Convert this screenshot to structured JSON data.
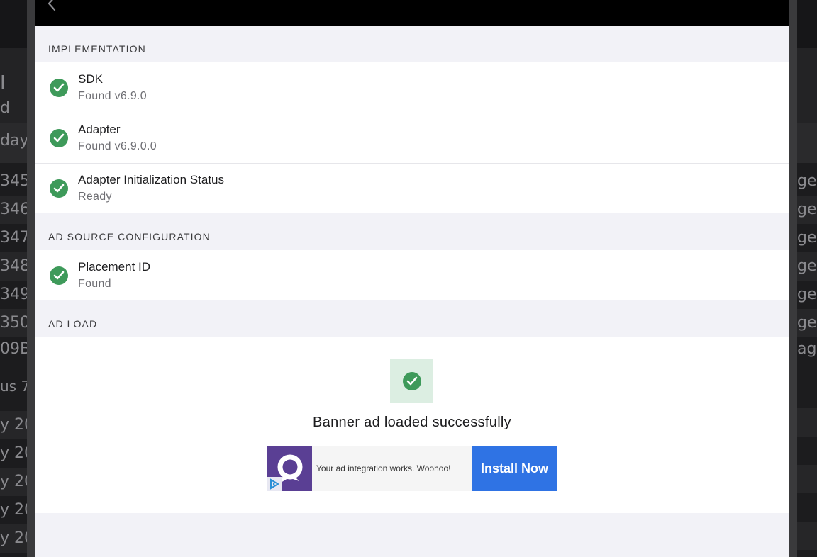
{
  "background": {
    "left_fragments": [
      "I",
      "d",
      "day"
    ],
    "left_list": [
      "345",
      "346",
      "347",
      "348",
      "349",
      "350",
      "09B",
      "us 7",
      "y 20",
      "y 20",
      "y 20",
      "y 20",
      "y 20"
    ],
    "right_list": [
      "ge",
      "ge",
      "ge",
      "ge",
      "ge",
      "ge",
      "age"
    ]
  },
  "sections": {
    "implementation": {
      "title": "IMPLEMENTATION",
      "rows": [
        {
          "title": "SDK",
          "subtitle": "Found v6.9.0"
        },
        {
          "title": "Adapter",
          "subtitle": "Found v6.9.0.0"
        },
        {
          "title": "Adapter Initialization Status",
          "subtitle": "Ready"
        }
      ]
    },
    "ad_source": {
      "title": "AD SOURCE CONFIGURATION",
      "rows": [
        {
          "title": "Placement ID",
          "subtitle": "Found"
        }
      ]
    },
    "ad_load": {
      "title": "AD LOAD",
      "status_text": "Banner ad loaded successfully",
      "banner": {
        "message": "Your ad integration works. Woohoo!",
        "button_label": "Install Now"
      }
    }
  },
  "colors": {
    "success": "#3e9a5a",
    "success_bg": "#dceee2",
    "install_button": "#2f73e4",
    "ad_logo": "#5a3f94"
  },
  "icons": {
    "back": "chevron-left-icon",
    "status": "check-circle-icon"
  }
}
